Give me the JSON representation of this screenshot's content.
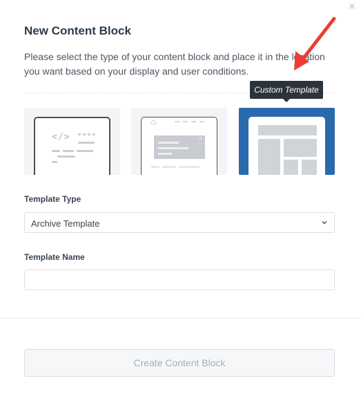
{
  "dialog": {
    "title": "New Content Block",
    "description": "Please select the type of your content block and place it in the location you want based on your display and user conditions.",
    "close_icon": "close-icon"
  },
  "block_types": [
    {
      "name": "code-snippet",
      "icon": "code-editor-icon",
      "selected": false
    },
    {
      "name": "popup",
      "icon": "popup-window-icon",
      "selected": false
    },
    {
      "name": "custom-template",
      "icon": "page-layout-icon",
      "selected": true
    }
  ],
  "tooltip": {
    "text": "Custom Template"
  },
  "template_type": {
    "label": "Template Type",
    "value": "Archive Template"
  },
  "template_name": {
    "label": "Template Name",
    "value": "",
    "placeholder": ""
  },
  "actions": {
    "create_label": "Create Content Block"
  },
  "colors": {
    "selected_card": "#2a6aad",
    "annotation_arrow": "#ec3b35",
    "tooltip_bg": "#2c333a"
  }
}
